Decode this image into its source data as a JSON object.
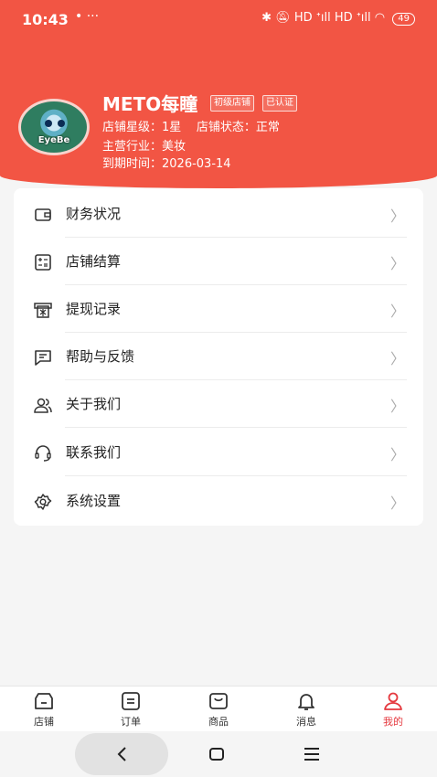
{
  "status_bar": {
    "time": "10:43",
    "extra": "• ···",
    "signal": "HD ᐩıll HD ᐩıll",
    "battery": "49"
  },
  "profile": {
    "shop_name": "METO每瞳",
    "tags": [
      "初级店铺",
      "已认证"
    ],
    "avatar_label": "EyeBe",
    "star_level": "店铺星级：1星",
    "shop_status": "店铺状态：正常",
    "industry": "主营行业：美妆",
    "expiry": "到期时间：2026-03-14"
  },
  "menu": [
    {
      "label": "财务状况",
      "icon": "wallet-icon"
    },
    {
      "label": "店铺结算",
      "icon": "calculator-icon"
    },
    {
      "label": "提现记录",
      "icon": "withdraw-icon"
    },
    {
      "label": "帮助与反馈",
      "icon": "chat-icon"
    },
    {
      "label": "关于我们",
      "icon": "users-icon"
    },
    {
      "label": "联系我们",
      "icon": "headset-icon"
    },
    {
      "label": "系统设置",
      "icon": "gear-icon"
    }
  ],
  "tabs": [
    {
      "label": "店铺",
      "icon": "store-icon"
    },
    {
      "label": "订单",
      "icon": "order-icon"
    },
    {
      "label": "商品",
      "icon": "product-icon"
    },
    {
      "label": "消息",
      "icon": "bell-icon"
    },
    {
      "label": "我的",
      "icon": "user-icon",
      "active": true
    }
  ],
  "colors": {
    "brand": "#f25544",
    "active_tab": "#e5393f"
  }
}
